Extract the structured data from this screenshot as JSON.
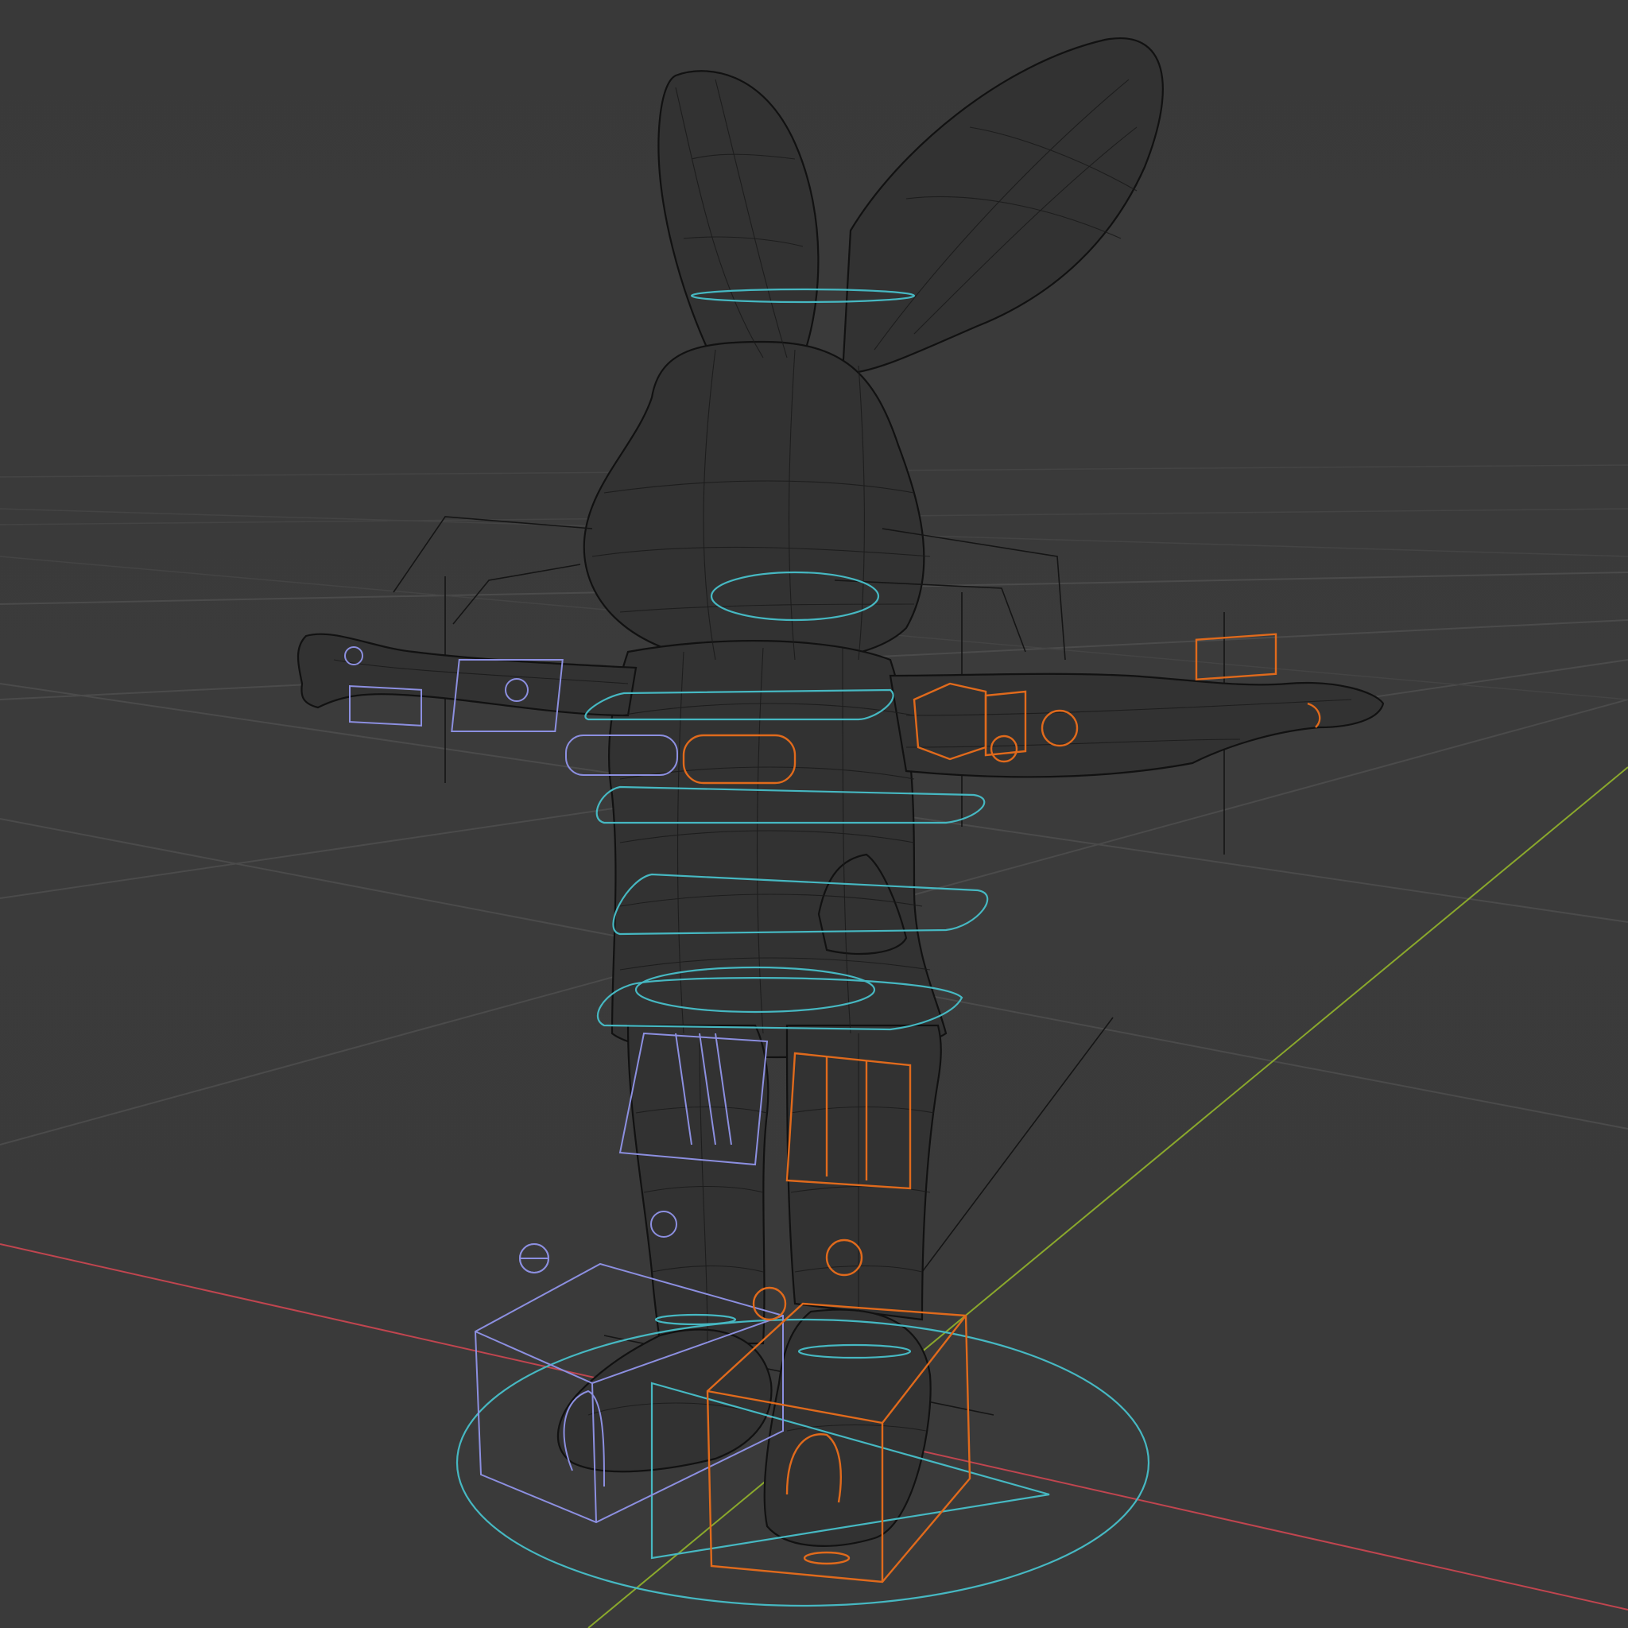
{
  "viewport": {
    "mode": "wireframe",
    "object": "rabbit-character-rig",
    "colors": {
      "background": "#3a3a3a",
      "grid": "#4b4b4b",
      "x_axis": "#c0454f",
      "y_axis": "#8aa82c",
      "mesh_wire": "#111111",
      "control_center": "#46b8c2",
      "control_right": "#e06a1c",
      "control_left": "#8c8fe0"
    },
    "controls": [
      {
        "name": "head-ring",
        "side": "center"
      },
      {
        "name": "neck-ring",
        "side": "center"
      },
      {
        "name": "chest-ring",
        "side": "center"
      },
      {
        "name": "spine-ring",
        "side": "center"
      },
      {
        "name": "hips-ring",
        "side": "center"
      },
      {
        "name": "root-circle",
        "side": "center"
      },
      {
        "name": "arm-ik",
        "side": "left"
      },
      {
        "name": "arm-ik",
        "side": "right"
      },
      {
        "name": "leg-ik",
        "side": "left"
      },
      {
        "name": "leg-ik",
        "side": "right"
      },
      {
        "name": "foot-box",
        "side": "left"
      },
      {
        "name": "foot-box",
        "side": "right"
      }
    ]
  }
}
